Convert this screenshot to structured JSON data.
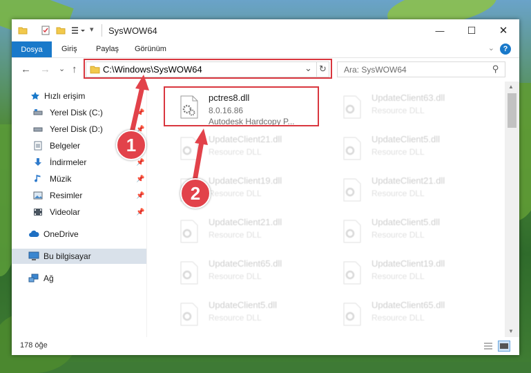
{
  "window": {
    "title": "SysWOW64",
    "minimize_glyph": "—",
    "maximize_glyph": "☐",
    "close_glyph": "✕"
  },
  "ribbon": {
    "tabs": [
      "Dosya",
      "Giriş",
      "Paylaş",
      "Görünüm"
    ],
    "collapse_glyph": "⌄",
    "help_glyph": "?"
  },
  "nav": {
    "back_glyph": "←",
    "forward_glyph": "→",
    "recent_glyph": "⌄",
    "up_glyph": "↑",
    "address": "C:\\Windows\\SysWOW64",
    "address_dropdown_glyph": "⌄",
    "refresh_glyph": "↻",
    "search_placeholder": "Ara: SysWOW64",
    "search_glyph": "⚲"
  },
  "sidebar": {
    "items": [
      {
        "label": "Hızlı erişim",
        "icon": "star-icon",
        "pinned": false
      },
      {
        "label": "Yerel Disk (C:)",
        "icon": "drive-icon",
        "pinned": true
      },
      {
        "label": "Yerel Disk (D:)",
        "icon": "drive-icon",
        "pinned": true
      },
      {
        "label": "Belgeler",
        "icon": "document-icon",
        "pinned": true
      },
      {
        "label": "İndirmeler",
        "icon": "download-icon",
        "pinned": true
      },
      {
        "label": "Müzik",
        "icon": "music-icon",
        "pinned": true
      },
      {
        "label": "Resimler",
        "icon": "pictures-icon",
        "pinned": true
      },
      {
        "label": "Videolar",
        "icon": "video-icon",
        "pinned": true
      },
      {
        "label": "OneDrive",
        "icon": "cloud-icon",
        "pinned": false
      },
      {
        "label": "Bu bilgisayar",
        "icon": "computer-icon",
        "pinned": false,
        "selected": true
      },
      {
        "label": "Ağ",
        "icon": "network-icon",
        "pinned": false
      }
    ],
    "pin_glyph": "📌"
  },
  "files": [
    {
      "name": "pctres8.dll",
      "line1": "8.0.16.86",
      "line2": "Autodesk Hardcopy P...",
      "highlighted": true
    },
    {
      "name": "UpdateClient63.dll",
      "line1": "Resource DLL"
    },
    {
      "name": "UpdateClient21.dll",
      "line1": "Resource DLL"
    },
    {
      "name": "UpdateClient5.dll",
      "line1": "Resource DLL"
    },
    {
      "name": "UpdateClient19.dll",
      "line1": "Resource DLL"
    },
    {
      "name": "UpdateClient21.dll",
      "line1": "Resource DLL"
    },
    {
      "name": "UpdateClient21.dll",
      "line1": "Resource DLL"
    },
    {
      "name": "UpdateClient5.dll",
      "line1": "Resource DLL"
    },
    {
      "name": "UpdateClient65.dll",
      "line1": "Resource DLL"
    },
    {
      "name": "UpdateClient19.dll",
      "line1": "Resource DLL"
    },
    {
      "name": "UpdateClient5.dll",
      "line1": "Resource DLL"
    },
    {
      "name": "UpdateClient65.dll",
      "line1": "Resource DLL"
    }
  ],
  "status": {
    "item_count": "178 öğe"
  },
  "annotations": {
    "step1": "1",
    "step2": "2",
    "color": "#e2424a"
  },
  "colors": {
    "accent": "#1979ca",
    "highlight": "#d9363e",
    "selection": "#d9e1ea"
  }
}
